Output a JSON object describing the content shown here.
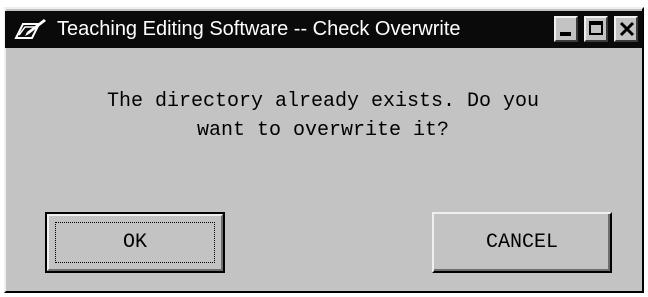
{
  "window": {
    "title": "Teaching Editing Software -- Check Overwrite",
    "icon": "app-pen-icon",
    "controls": {
      "minimize_icon": "minimize-icon",
      "maximize_icon": "maximize-icon",
      "close_icon": "close-icon"
    }
  },
  "dialog": {
    "message_line1": "The directory already exists. Do you",
    "message_line2": "want to overwrite it?",
    "ok_label": "OK",
    "cancel_label": "CANCEL"
  },
  "colors": {
    "titlebar": "#0a0a0a",
    "face": "#c3c3c3",
    "text": "#000000",
    "title_text": "#ffffff"
  }
}
